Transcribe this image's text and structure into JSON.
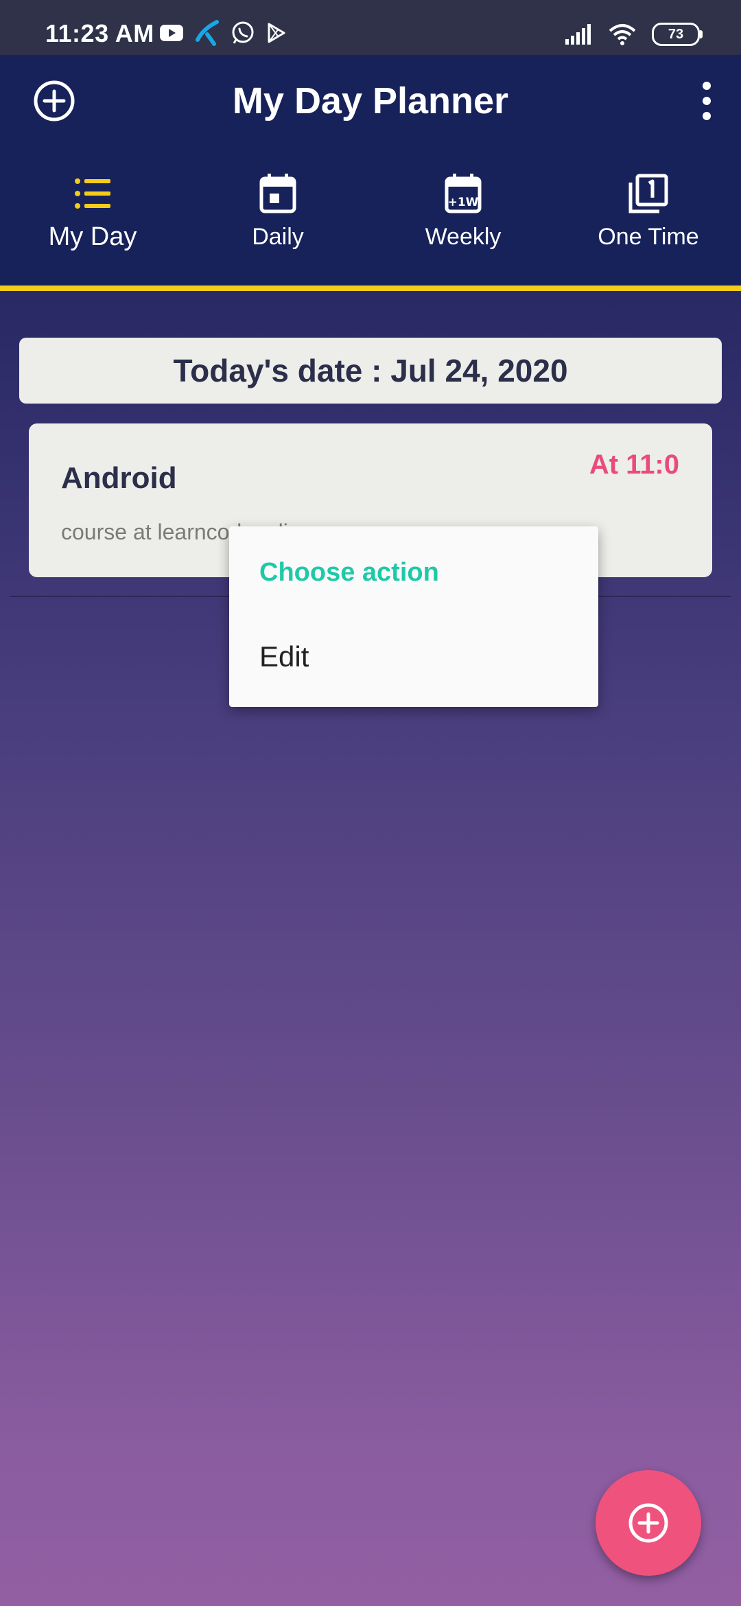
{
  "status_bar": {
    "time": "11:23 AM",
    "battery": "73",
    "left_icons": [
      "youtube-icon",
      "telenor-icon",
      "whatsapp-icon",
      "play-store-icon"
    ],
    "right_icons": [
      "signal-icon",
      "wifi-icon",
      "battery-icon"
    ]
  },
  "app_bar": {
    "title": "My Day Planner",
    "add_icon": "plus-circle-icon",
    "more_icon": "more-vertical-icon"
  },
  "tabs": [
    {
      "label": "My Day",
      "icon": "list-icon",
      "active": true
    },
    {
      "label": "Daily",
      "icon": "calendar-day-icon",
      "active": false
    },
    {
      "label": "Weekly",
      "icon": "calendar-week-icon",
      "active": false
    },
    {
      "label": "One Time",
      "icon": "filter-1-icon",
      "active": false
    }
  ],
  "date_banner": {
    "text": "Today's date : Jul 24, 2020"
  },
  "task": {
    "title": "Android",
    "time": "At 11:0",
    "description": "course at learncodeonli"
  },
  "context_menu": {
    "title": "Choose action",
    "items": [
      "Edit"
    ]
  },
  "fab": {
    "icon": "plus-circle-icon"
  },
  "colors": {
    "app_bar": "#17225a",
    "accent_yellow": "#f5cc1a",
    "menu_title": "#1ec9a8",
    "task_time": "#e94b7e",
    "fab": "#f0527e"
  }
}
